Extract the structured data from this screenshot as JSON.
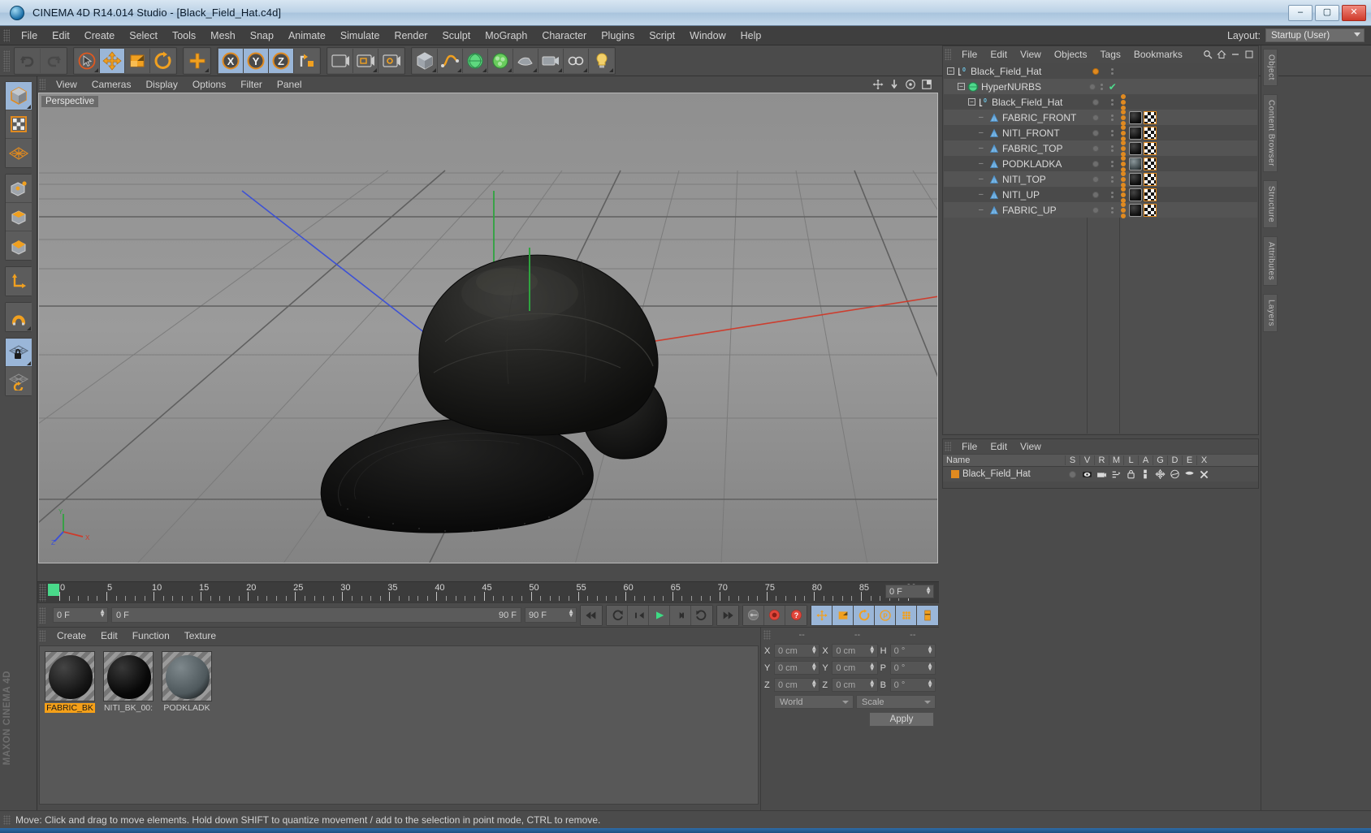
{
  "titlebar": {
    "title": "CINEMA 4D R14.014 Studio - [Black_Field_Hat.c4d]",
    "minimize": "–",
    "maximize": "▢",
    "close": "✕"
  },
  "menubar": {
    "items": [
      "File",
      "Edit",
      "Create",
      "Select",
      "Tools",
      "Mesh",
      "Snap",
      "Animate",
      "Simulate",
      "Render",
      "Sculpt",
      "MoGraph",
      "Character",
      "Plugins",
      "Script",
      "Window",
      "Help"
    ],
    "layout_label": "Layout:",
    "layout_value": "Startup (User)"
  },
  "viewport": {
    "menu": [
      "View",
      "Cameras",
      "Display",
      "Options",
      "Filter",
      "Panel"
    ],
    "label": "Perspective",
    "axis_x": "X",
    "axis_y": "Y",
    "axis_z": "Z"
  },
  "timeline": {
    "ticks": [
      "0",
      "5",
      "10",
      "15",
      "20",
      "25",
      "30",
      "35",
      "40",
      "45",
      "50",
      "55",
      "60",
      "65",
      "70",
      "75",
      "80",
      "85",
      "90"
    ],
    "current_frame_field": "0 F",
    "start_field": "0 F",
    "range_start": "0 F",
    "range_end": "90 F",
    "end_field": "90 F"
  },
  "material_manager": {
    "menu": [
      "Create",
      "Edit",
      "Function",
      "Texture"
    ],
    "materials": [
      {
        "name": "FABRIC_BK",
        "selected": true,
        "color": "#151515"
      },
      {
        "name": "NITI_BK_00:",
        "selected": false,
        "color": "#080808"
      },
      {
        "name": "PODKLADK",
        "selected": false,
        "color": "#4e585c"
      }
    ]
  },
  "coordinates": {
    "header": [
      "--",
      "--",
      "--"
    ],
    "rows": [
      {
        "l1": "X",
        "v1": "0 cm",
        "l2": "X",
        "v2": "0 cm",
        "l3": "H",
        "v3": "0 °"
      },
      {
        "l1": "Y",
        "v1": "0 cm",
        "l2": "Y",
        "v2": "0 cm",
        "l3": "P",
        "v3": "0 °"
      },
      {
        "l1": "Z",
        "v1": "0 cm",
        "l2": "Z",
        "v2": "0 cm",
        "l3": "B",
        "v3": "0 °"
      }
    ],
    "world_select": "World",
    "scale_select": "Scale",
    "apply_button": "Apply"
  },
  "object_manager": {
    "menu": [
      "File",
      "Edit",
      "View",
      "Objects",
      "Tags",
      "Bookmarks"
    ],
    "rows": [
      {
        "name": "Black_Field_Hat",
        "depth": 0,
        "icon": "null-object-icon",
        "expandable": true,
        "dot": "orange",
        "check": false,
        "tags": []
      },
      {
        "name": "HyperNURBS",
        "depth": 1,
        "icon": "hypernurbs-icon",
        "expandable": true,
        "dot": "grey",
        "check": true,
        "tags": []
      },
      {
        "name": "Black_Field_Hat",
        "depth": 2,
        "icon": "null-object-icon",
        "expandable": true,
        "dot": "grey",
        "check": false,
        "tags": [
          "select"
        ]
      },
      {
        "name": "FABRIC_FRONT",
        "depth": 3,
        "icon": "polygon-object-icon",
        "expandable": false,
        "dot": "grey",
        "check": false,
        "tags": [
          "select",
          "material",
          "uv"
        ]
      },
      {
        "name": "NITI_FRONT",
        "depth": 3,
        "icon": "polygon-object-icon",
        "expandable": false,
        "dot": "grey",
        "check": false,
        "tags": [
          "select",
          "material",
          "uv"
        ]
      },
      {
        "name": "FABRIC_TOP",
        "depth": 3,
        "icon": "polygon-object-icon",
        "expandable": false,
        "dot": "grey",
        "check": false,
        "tags": [
          "select",
          "material",
          "uv"
        ]
      },
      {
        "name": "PODKLADKA",
        "depth": 3,
        "icon": "polygon-object-icon",
        "expandable": false,
        "dot": "grey",
        "check": false,
        "tags": [
          "select",
          "material-grey",
          "uv"
        ]
      },
      {
        "name": "NITI_TOP",
        "depth": 3,
        "icon": "polygon-object-icon",
        "expandable": false,
        "dot": "grey",
        "check": false,
        "tags": [
          "select",
          "material",
          "uv"
        ]
      },
      {
        "name": "NITI_UP",
        "depth": 3,
        "icon": "polygon-object-icon",
        "expandable": false,
        "dot": "grey",
        "check": false,
        "tags": [
          "select",
          "material",
          "uv"
        ]
      },
      {
        "name": "FABRIC_UP",
        "depth": 3,
        "icon": "polygon-object-icon",
        "expandable": false,
        "dot": "grey",
        "check": false,
        "tags": [
          "select",
          "material",
          "uv"
        ]
      }
    ]
  },
  "layer_manager": {
    "menu": [
      "File",
      "Edit",
      "View"
    ],
    "columns": [
      "Name",
      "S",
      "V",
      "R",
      "M",
      "L",
      "A",
      "G",
      "D",
      "E",
      "X"
    ],
    "rows": [
      {
        "name": "Black_Field_Hat"
      }
    ]
  },
  "dock": {
    "tabs": [
      "Object",
      "Content Browser",
      "Structure",
      "Attributes",
      "Layers"
    ]
  },
  "statusbar": {
    "message": "Move: Click and drag to move elements. Hold down SHIFT to quantize movement / add to the selection in point mode, CTRL to remove."
  },
  "colors": {
    "accent_orange": "#e08a20",
    "accent_blue": "#9ab6d8",
    "green": "#49d98a",
    "panel": "#4b4b4b"
  }
}
